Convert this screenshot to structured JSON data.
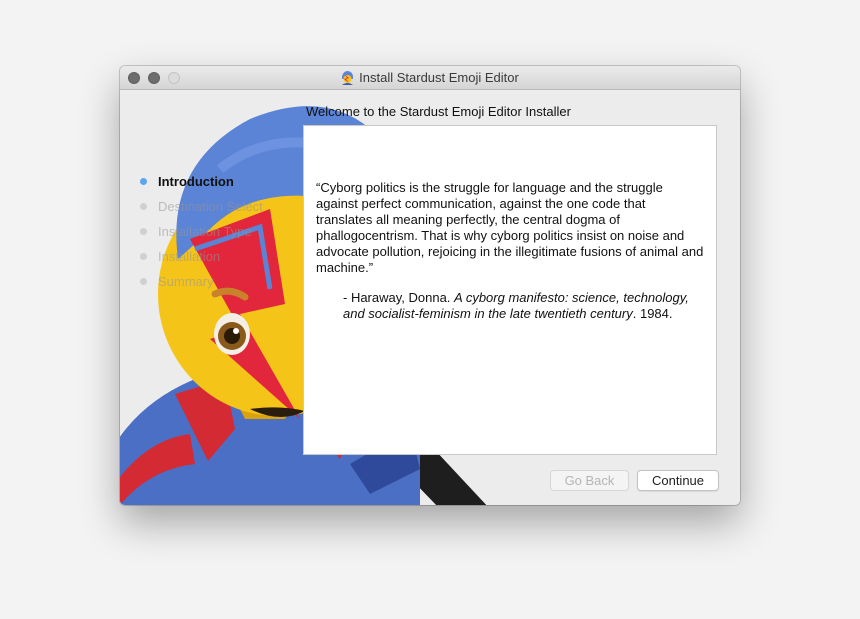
{
  "window": {
    "title": "Install Stardust Emoji Editor",
    "title_icon": "stardust-person-emoji-icon"
  },
  "header": {
    "welcome": "Welcome to the Stardust Emoji Editor Installer"
  },
  "sidebar": {
    "steps": [
      {
        "label": "Introduction",
        "active": true
      },
      {
        "label": "Destination Select",
        "active": false
      },
      {
        "label": "Installation Type",
        "active": false
      },
      {
        "label": "Installation",
        "active": false
      },
      {
        "label": "Summary",
        "active": false
      }
    ]
  },
  "main": {
    "quote": "“Cyborg politics is the struggle for language and the struggle against perfect communication, against the one code that translates all meaning perfectly, the central dogma of phallogocentrism. That is why cyborg politics insist on noise and advocate pollution, rejoicing in the illegitimate fusions of animal and machine.”",
    "citation_prefix": "- Haraway, Donna. ",
    "citation_title": "A cyborg manifesto: science, technology, and socialist-feminism in the late twentieth century",
    "citation_suffix": ". 1984."
  },
  "buttons": {
    "back": "Go Back",
    "continue": "Continue"
  },
  "colors": {
    "active_step_dot": "#5aa7f0",
    "emoji_hair": "#5b83d6",
    "emoji_skin": "#f5c419",
    "emoji_bolt": "#e2263b"
  }
}
